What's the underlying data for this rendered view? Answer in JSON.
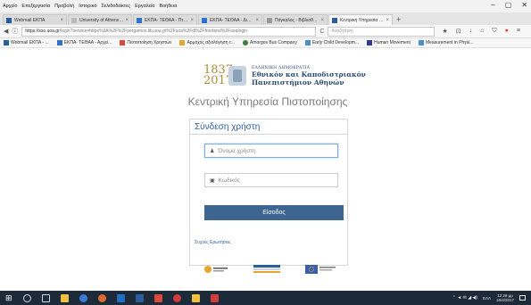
{
  "browser": {
    "menu": [
      "Αρχείο",
      "Επεξεργασία",
      "Προβολή",
      "Ιστορικό",
      "Σελιδοδείκτες",
      "Εργαλεία",
      "Βοήθεια"
    ],
    "tabs": [
      {
        "label": "Webmail EKΠA",
        "fav_color": "#2b5d9a",
        "active": false
      },
      {
        "label": "University of Athens [TYPO3 4.5",
        "fav_color": "#bbbbbb",
        "active": false
      },
      {
        "label": "ΕΚΠΑ- ΤΕΘΑΑ - Πτυχιακή",
        "fav_color": "#2f72c9",
        "active": false
      },
      {
        "label": "ΕΚΠΑ- ΤΕΘΑΑ - Διαδικασία",
        "fav_color": "#2f72c9",
        "active": false
      },
      {
        "label": "Πάγκαλος - Βιβλιοθήκη και",
        "fav_color": "#999999",
        "active": false
      },
      {
        "label": "Κεντρική Υπηρεσία Πιστοπ",
        "fav_color": "#2b5d9a",
        "active": true
      }
    ],
    "new_tab": "+",
    "window_controls": [
      "–",
      "▢",
      "✕"
    ],
    "nav": {
      "back": "◀",
      "info": "ⓘ",
      "lock": "🔒"
    },
    "url": {
      "host": "https://sso.uoa.gr",
      "path": "/login?service=https%3A%2F%2Fpergamos.lib.uoa.gr%2Fuoa%2Fdl%2Ffrontend%2Fuoalogin"
    },
    "reload": "C",
    "search_placeholder": "Αναζήτηση",
    "toolbar_icons": [
      "★",
      "⊡",
      "↓",
      "⌂",
      "⛉",
      "●",
      "≡"
    ],
    "bookmarks": [
      {
        "label": "Webmail ΕΚΠΑ - ...",
        "color": "#2b5d9a"
      },
      {
        "label": "ΕΚΠΑ- ΤΕΘΑΑ - Αρχεί...",
        "color": "#2f72c9"
      },
      {
        "label": "Πιστοποίηση Χρηστών",
        "color": "#d94a3a"
      },
      {
        "label": "Αρμοχός αξιολόγηση τ...",
        "color": "#e2a92c"
      },
      {
        "label": "Amorgos Bus Company",
        "color": "#3b7d3b"
      },
      {
        "label": "Early Child Developm...",
        "color": "#4a90c8"
      },
      {
        "label": "Human Movement",
        "color": "#2f3b8a"
      },
      {
        "label": "Measurement in Physi...",
        "color": "#4a90c8"
      }
    ]
  },
  "page": {
    "logo": {
      "year_top": "1837",
      "year_bottom": "2017",
      "small": "ΕΛΛΗΝΙΚΗ ΔΗΜΟΚΡΑΤΙΑ",
      "line1": "Εθνικόν και Καποδιστριακόν",
      "line2": "Πανεπιστήμιον Αθηνών"
    },
    "service_title": "Κεντρική Υπηρεσία Πιστοποίησης",
    "login": {
      "header": "Σύνδεση χρήστη",
      "username_placeholder": "Όνομα χρήστη",
      "password_placeholder": "Κωδικός",
      "submit": "Είσοδος",
      "faq": "Συχνές Ερωτήσεις"
    },
    "partner_colors": [
      "#e6a52c",
      "#2b5d9a",
      "#3c5ea8"
    ]
  },
  "taskbar": {
    "start": "⊞",
    "apps": [
      "#cfd8e2",
      "#f0c040",
      "#3a7bd5",
      "#2b7fd6",
      "#d94a3a",
      "#1e6fc1",
      "#2b5d9a",
      "#d94a3a",
      "#e06a2c",
      "#d13b3b"
    ],
    "tray_icons": "⌃ ◄ ✉ ◢ ◀)",
    "lang": "ΕΛΛ",
    "time": "12:28 μμ",
    "date": "16/4/2017"
  }
}
